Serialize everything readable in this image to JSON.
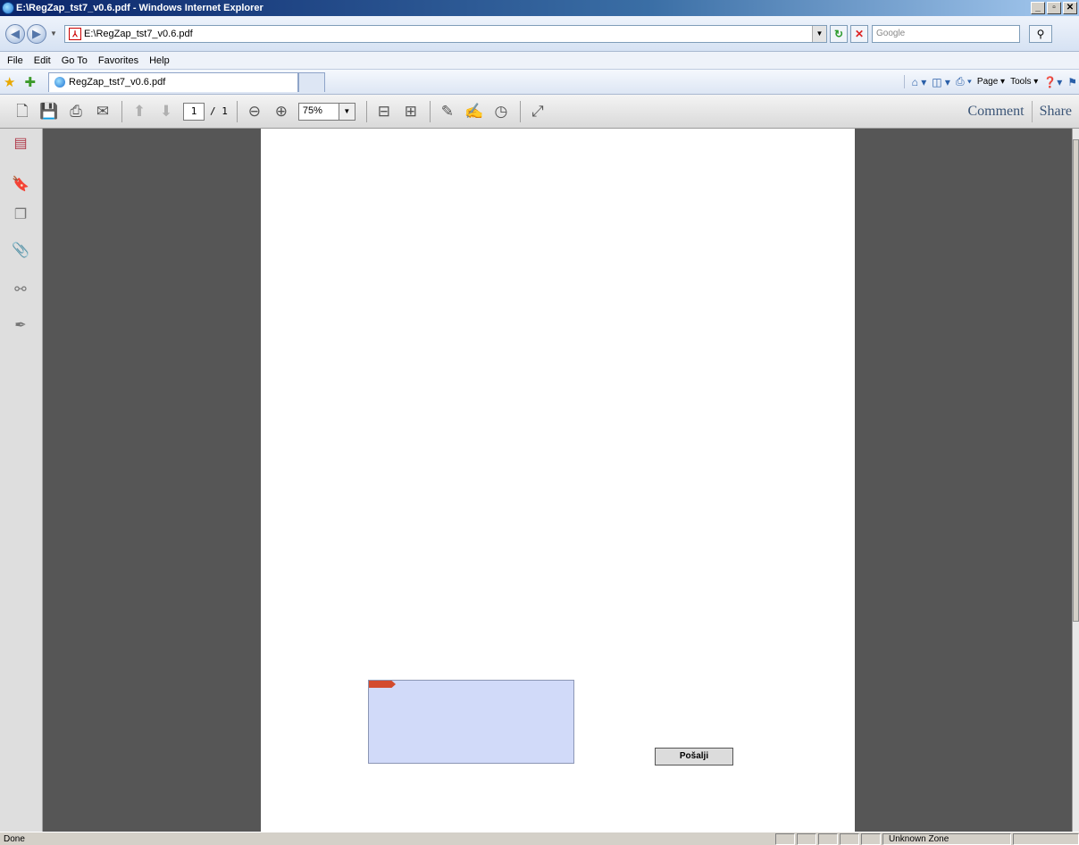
{
  "window": {
    "title": "E:\\RegZap_tst7_v0.6.pdf - Windows Internet Explorer",
    "controls": [
      "_",
      "▫",
      "✕"
    ]
  },
  "address_bar": {
    "url": "E:\\RegZap_tst7_v0.6.pdf",
    "search_placeholder": "Google"
  },
  "menu": {
    "items": [
      "File",
      "Edit",
      "Go To",
      "Favorites",
      "Help"
    ]
  },
  "tabs": {
    "active_label": "RegZap_tst7_v0.6.pdf"
  },
  "command_bar": {
    "page_label": "Page",
    "tools_label": "Tools"
  },
  "acrobat_toolbar": {
    "current_page": "1",
    "total_pages": "/ 1",
    "zoom": "75%",
    "comment_label": "Comment",
    "share_label": "Share"
  },
  "document": {
    "send_button_label": "Pošalji"
  },
  "status_bar": {
    "status": "Done",
    "zone": "Unknown Zone"
  }
}
